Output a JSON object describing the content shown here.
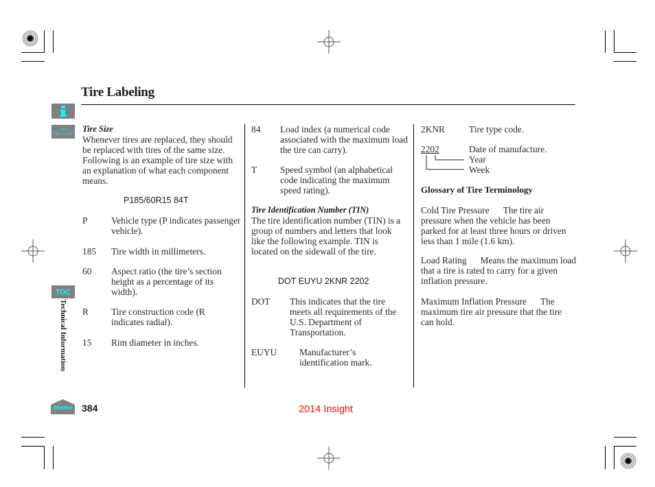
{
  "page": {
    "title": "Tire Labeling",
    "section_tab": "Technical Information",
    "page_number": "384",
    "footer_model": "2014 Insight"
  },
  "nav": {
    "info_icon": "info-icon",
    "car_icon": "car-icon",
    "toc_label": "TOC",
    "home_label": "Home",
    "accent_color": "#00ffff",
    "button_bg": "#808080"
  },
  "tire_size": {
    "heading": "Tire Size",
    "intro": "Whenever tires are replaced, they should be replaced with tires of the same size. Following is an example of tire size with an explanation of what each component means.",
    "example": "P185/60R15 84T",
    "items": [
      {
        "code": "P",
        "desc": "Vehicle type (P indicates passenger vehicle)."
      },
      {
        "code": "185",
        "desc": "Tire width in millimeters."
      },
      {
        "code": "60",
        "desc": "Aspect ratio (the tire’s section height as a percentage of its width)."
      },
      {
        "code": "R",
        "desc": "Tire construction code (R indicates radial)."
      },
      {
        "code": "15",
        "desc": "Rim diameter in inches."
      },
      {
        "code": "84",
        "desc": "Load index (a numerical code associated with the maximum load the tire can carry)."
      },
      {
        "code": "T",
        "desc": "Speed symbol (an alphabetical code indicating the maximum speed rating)."
      }
    ]
  },
  "tin": {
    "heading": "Tire Identification Number (TIN)",
    "intro": "The tire identification number (TIN) is a group of numbers and letters that look like the following example. TIN is located on the sidewall of the tire.",
    "example": "DOT EUYU 2KNR 2202",
    "items": [
      {
        "code": "DOT",
        "desc": "This indicates that the tire meets all requirements of the U.S. Department of Transportation."
      },
      {
        "code": "EUYU",
        "desc": "Manufacturer’s identification mark."
      },
      {
        "code": "2KNR",
        "desc": "Tire type code."
      },
      {
        "code": "2202",
        "desc": "Date of manufacture."
      }
    ],
    "date_parts": {
      "year": "Year",
      "week": "Week"
    }
  },
  "glossary": {
    "heading": "Glossary of Tire Terminology",
    "terms": [
      {
        "term": "Cold Tire Pressure",
        "def": "The tire air pressure when the vehicle has been parked for at least three hours or driven less than 1 mile (1.6 km)."
      },
      {
        "term": "Load Rating",
        "def": "Means the maximum load that a tire is rated to carry for a given inflation pressure."
      },
      {
        "term": "Maximum Inflation Pressure",
        "def": "The maximum tire air pressure that the tire can hold."
      }
    ]
  }
}
